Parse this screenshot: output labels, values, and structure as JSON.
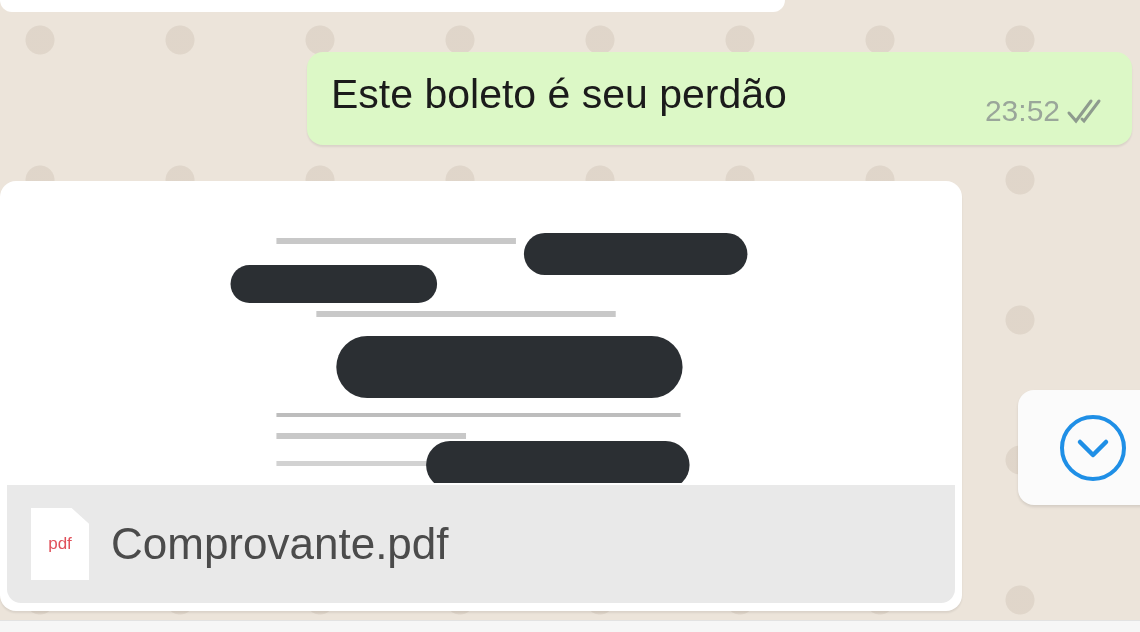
{
  "messages": [
    {
      "kind": "text",
      "outgoing": true,
      "text": "Este boleto é seu perdão",
      "time": "23:52",
      "read": false
    },
    {
      "kind": "document",
      "outgoing": false,
      "file_type": "pdf",
      "file_name": "Comprovante.pdf"
    }
  ]
}
